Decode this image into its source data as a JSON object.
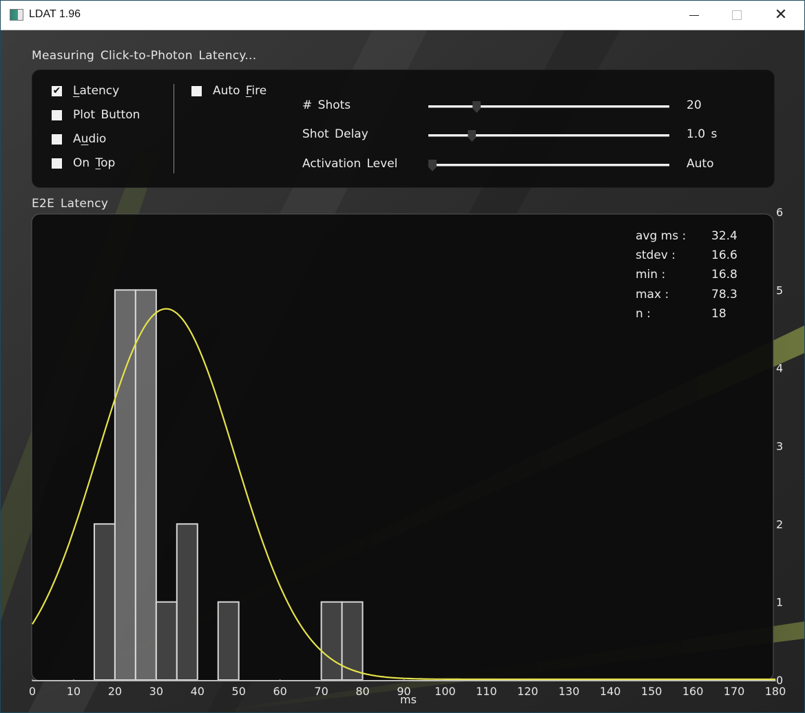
{
  "window": {
    "title": "LDAT 1.96",
    "controls": {
      "minimize": "minimize",
      "maximize": "maximize",
      "close": "close"
    }
  },
  "status_heading": "Measuring Click-to-Photon Latency...",
  "options": {
    "checkboxes": [
      {
        "label": "Latency",
        "mnemonic": "L",
        "checked": true
      },
      {
        "label": "Plot Button",
        "mnemonic": "",
        "checked": false
      },
      {
        "label": "Audio",
        "mnemonic": "u",
        "checked": false
      },
      {
        "label": "On Top",
        "mnemonic": "T",
        "checked": false
      }
    ],
    "auto_fire": {
      "label": "Auto Fire",
      "mnemonic": "F",
      "checked": false
    },
    "sliders": [
      {
        "label": "# Shots",
        "value_text": "20",
        "position_fraction": 0.19
      },
      {
        "label": "Shot Delay",
        "value_text": "1.0 s",
        "position_fraction": 0.17
      },
      {
        "label": "Activation Level",
        "value_text": "Auto",
        "position_fraction": 0.0
      }
    ]
  },
  "chart_section_heading": "E2E Latency",
  "stats": [
    {
      "label": "avg ms :",
      "value": "32.4"
    },
    {
      "label": "stdev :",
      "value": "16.6"
    },
    {
      "label": "min :",
      "value": "16.8"
    },
    {
      "label": "max :",
      "value": "78.3"
    },
    {
      "label": "n :",
      "value": "18"
    }
  ],
  "colors": {
    "curve": "#e6e34a",
    "bar_outline": "#d8d8d8",
    "panel": "#0e0e0e"
  },
  "chart_data": {
    "type": "bar",
    "title": "E2E Latency",
    "xlabel": "ms",
    "ylabel": "",
    "bin_width": 5,
    "bins": [
      {
        "start": 15,
        "end": 20,
        "count": 2
      },
      {
        "start": 20,
        "end": 25,
        "count": 5
      },
      {
        "start": 25,
        "end": 30,
        "count": 5
      },
      {
        "start": 30,
        "end": 35,
        "count": 1
      },
      {
        "start": 35,
        "end": 40,
        "count": 2
      },
      {
        "start": 45,
        "end": 50,
        "count": 1
      },
      {
        "start": 70,
        "end": 75,
        "count": 1
      },
      {
        "start": 75,
        "end": 80,
        "count": 1
      }
    ],
    "fit_curve": {
      "type": "normal",
      "mean": 32.4,
      "stdev": 16.6,
      "peak": 4.75
    },
    "xlim": [
      0,
      180
    ],
    "ylim": [
      0,
      6
    ],
    "x_ticks": [
      "0",
      "10",
      "20",
      "30",
      "40",
      "50",
      "60",
      "70",
      "80",
      "90",
      "100",
      "110",
      "120",
      "130",
      "140",
      "150",
      "160",
      "170",
      "180"
    ],
    "y_ticks": [
      "0",
      "1",
      "2",
      "3",
      "4",
      "5",
      "6"
    ],
    "y_axis_side": "right",
    "grid": false,
    "legend": "none"
  }
}
